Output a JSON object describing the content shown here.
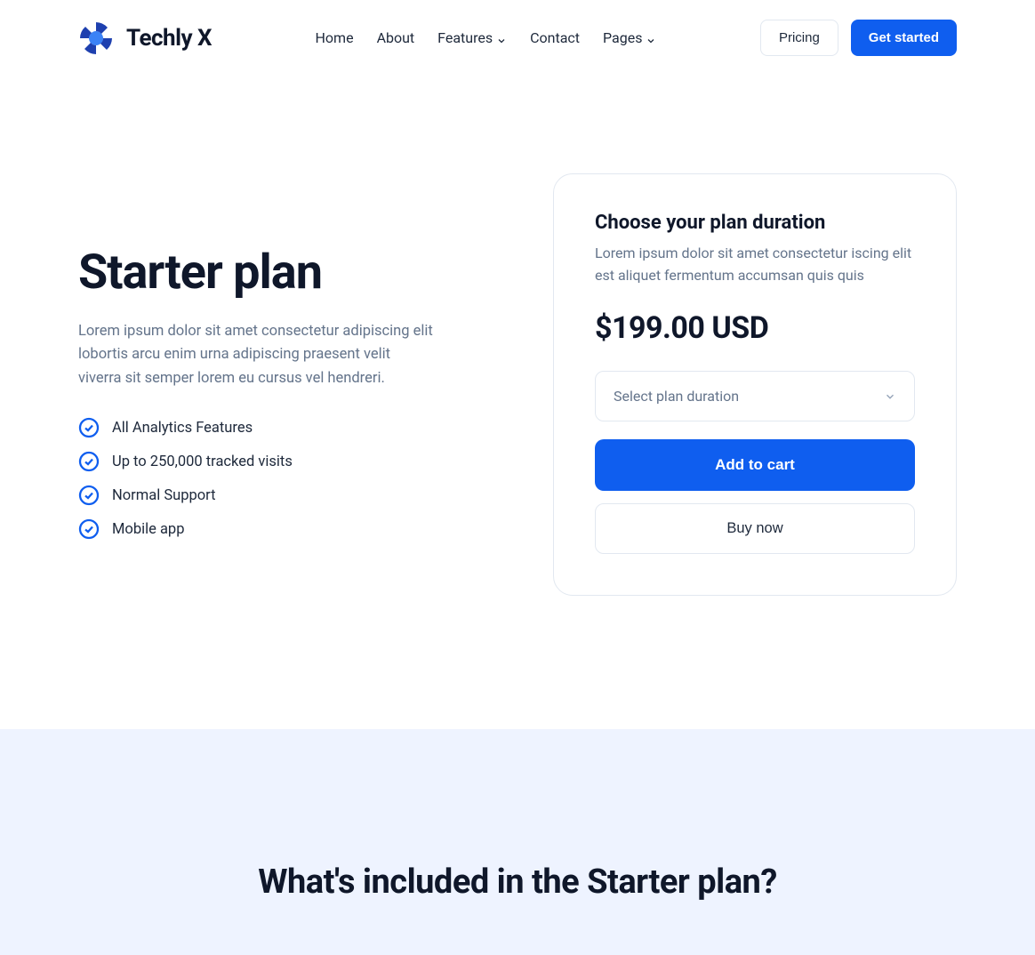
{
  "brand": "Techly X",
  "nav": {
    "home": "Home",
    "about": "About",
    "features": "Features",
    "contact": "Contact",
    "pages": "Pages"
  },
  "header_buttons": {
    "pricing": "Pricing",
    "get_started": "Get started"
  },
  "plan": {
    "title": "Starter plan",
    "description": "Lorem ipsum dolor sit amet consectetur adipiscing elit lobortis arcu enim urna adipiscing praesent velit viverra sit semper lorem eu cursus vel hendreri.",
    "features": [
      "All Analytics Features",
      "Up to 250,000 tracked visits",
      "Normal Support",
      "Mobile app"
    ]
  },
  "card": {
    "title": "Choose your plan duration",
    "subtitle": "Lorem ipsum dolor sit amet consectetur iscing elit est aliquet fermentum accumsan quis quis",
    "price": "$199.00 USD",
    "select_placeholder": "Select plan duration",
    "add_to_cart": "Add to cart",
    "buy_now": "Buy now"
  },
  "included_heading": "What's included in the Starter plan?",
  "colors": {
    "accent": "#0f5eef"
  }
}
